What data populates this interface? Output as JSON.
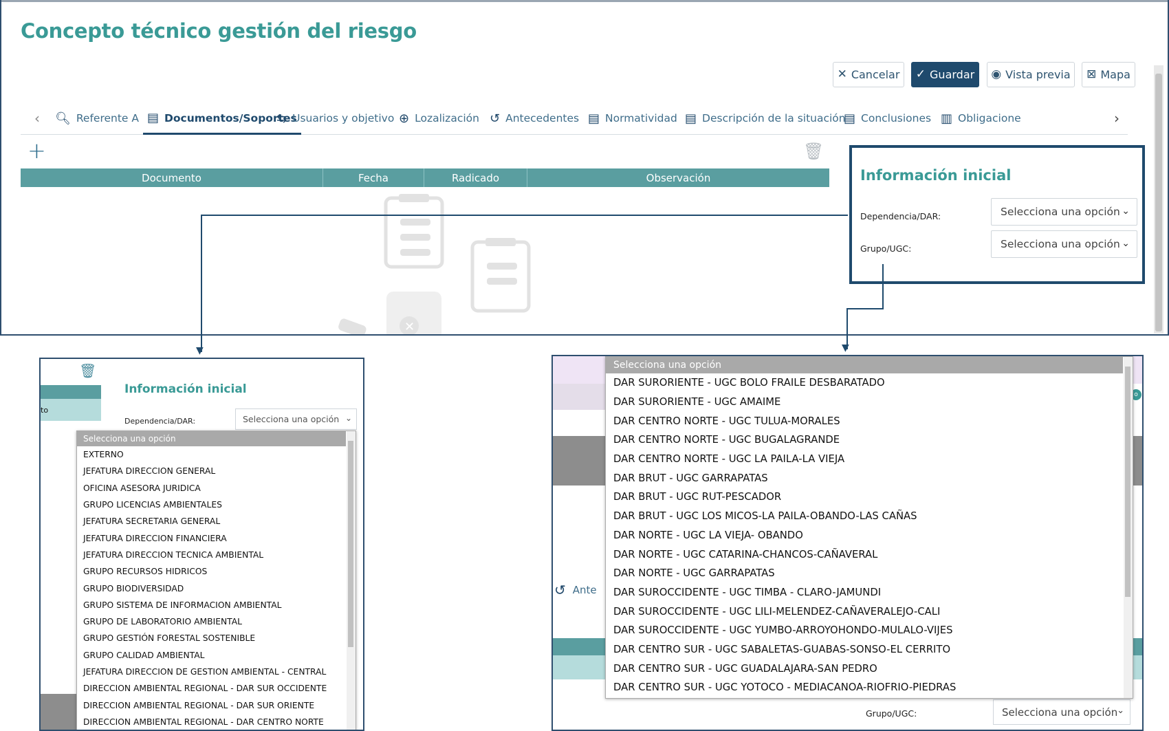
{
  "page": {
    "title": "Concepto técnico gestión del riesgo"
  },
  "actions": {
    "cancel": "Cancelar",
    "save": "Guardar",
    "preview": "Vista previa",
    "map": "Mapa"
  },
  "tabs": [
    {
      "label": "Referente A",
      "icon": "search-document-icon"
    },
    {
      "label": "Documentos/Soportes",
      "icon": "document-icon",
      "active": true
    },
    {
      "label": "Usuarios y objetivo",
      "icon": "swap-arrows-icon"
    },
    {
      "label": "Lozalización",
      "icon": "target-icon"
    },
    {
      "label": "Antecedentes",
      "icon": "history-icon"
    },
    {
      "label": "Normatividad",
      "icon": "document-icon"
    },
    {
      "label": "Descripción de la situación",
      "icon": "document-icon"
    },
    {
      "label": "Conclusiones",
      "icon": "document-icon"
    },
    {
      "label": "Obligacione",
      "icon": "clipboard-icon"
    }
  ],
  "documents_table": {
    "columns": [
      "Documento",
      "Fecha",
      "Radicado",
      "Observación"
    ]
  },
  "info_panel": {
    "title": "Información inicial",
    "dependencia_label": "Dependencia/DAR:",
    "grupo_label": "Grupo/UGC:",
    "placeholder": "Selecciona una opción"
  },
  "zoom_left": {
    "partial_row_text": "to",
    "dependencia_label": "Dependencia/DAR:",
    "options": [
      "EXTERNO",
      "JEFATURA DIRECCION GENERAL",
      "OFICINA ASESORA JURIDICA",
      "GRUPO LICENCIAS AMBIENTALES",
      "JEFATURA SECRETARIA GENERAL",
      "JEFATURA DIRECCION FINANCIERA",
      "JEFATURA DIRECCION TECNICA AMBIENTAL",
      "GRUPO RECURSOS HIDRICOS",
      "GRUPO BIODIVERSIDAD",
      "GRUPO SISTEMA DE INFORMACION AMBIENTAL",
      "GRUPO DE LABORATORIO AMBIENTAL",
      "GRUPO GESTIÓN FORESTAL SOSTENIBLE",
      "GRUPO CALIDAD AMBIENTAL",
      "JEFATURA DIRECCION DE GESTION AMBIENTAL - CENTRAL",
      "DIRECCION AMBIENTAL REGIONAL - DAR SUR OCCIDENTE",
      "DIRECCION AMBIENTAL REGIONAL - DAR SUR ORIENTE",
      "DIRECCION AMBIENTAL REGIONAL - DAR CENTRO NORTE"
    ]
  },
  "zoom_right": {
    "partial_tab": "Ante",
    "grupo_label": "Grupo/UGC:",
    "badge": "o",
    "options": [
      "DAR SURORIENTE - UGC BOLO FRAILE DESBARATADO",
      "DAR SURORIENTE - UGC AMAIME",
      "DAR CENTRO NORTE - UGC TULUA-MORALES",
      "DAR CENTRO NORTE - UGC BUGALAGRANDE",
      "DAR CENTRO NORTE - UGC LA PAILA-LA VIEJA",
      "DAR BRUT - UGC GARRAPATAS",
      "DAR BRUT - UGC RUT-PESCADOR",
      "DAR BRUT - UGC LOS MICOS-LA PAILA-OBANDO-LAS CAÑAS",
      "DAR NORTE - UGC LA VIEJA- OBANDO",
      "DAR NORTE - UGC CATARINA-CHANCOS-CAÑAVERAL",
      "DAR NORTE - UGC GARRAPATAS",
      "DAR SUROCCIDENTE - UGC TIMBA - CLARO-JAMUNDI",
      "DAR SUROCCIDENTE - UGC LILI-MELENDEZ-CAÑAVERALEJO-CALI",
      "DAR SUROCCIDENTE - UGC YUMBO-ARROYOHONDO-MULALO-VIJES",
      "DAR CENTRO SUR - UGC SABALETAS-GUABAS-SONSO-EL CERRITO",
      "DAR CENTRO SUR - UGC GUADALAJARA-SAN PEDRO",
      "DAR CENTRO SUR - UGC YOTOCO - MEDIACANOA-RIOFRIO-PIEDRAS"
    ]
  },
  "colors": {
    "accent_teal": "#3a9a96",
    "table_header": "#5a9ea0",
    "primary_navy": "#1f4a6d"
  }
}
